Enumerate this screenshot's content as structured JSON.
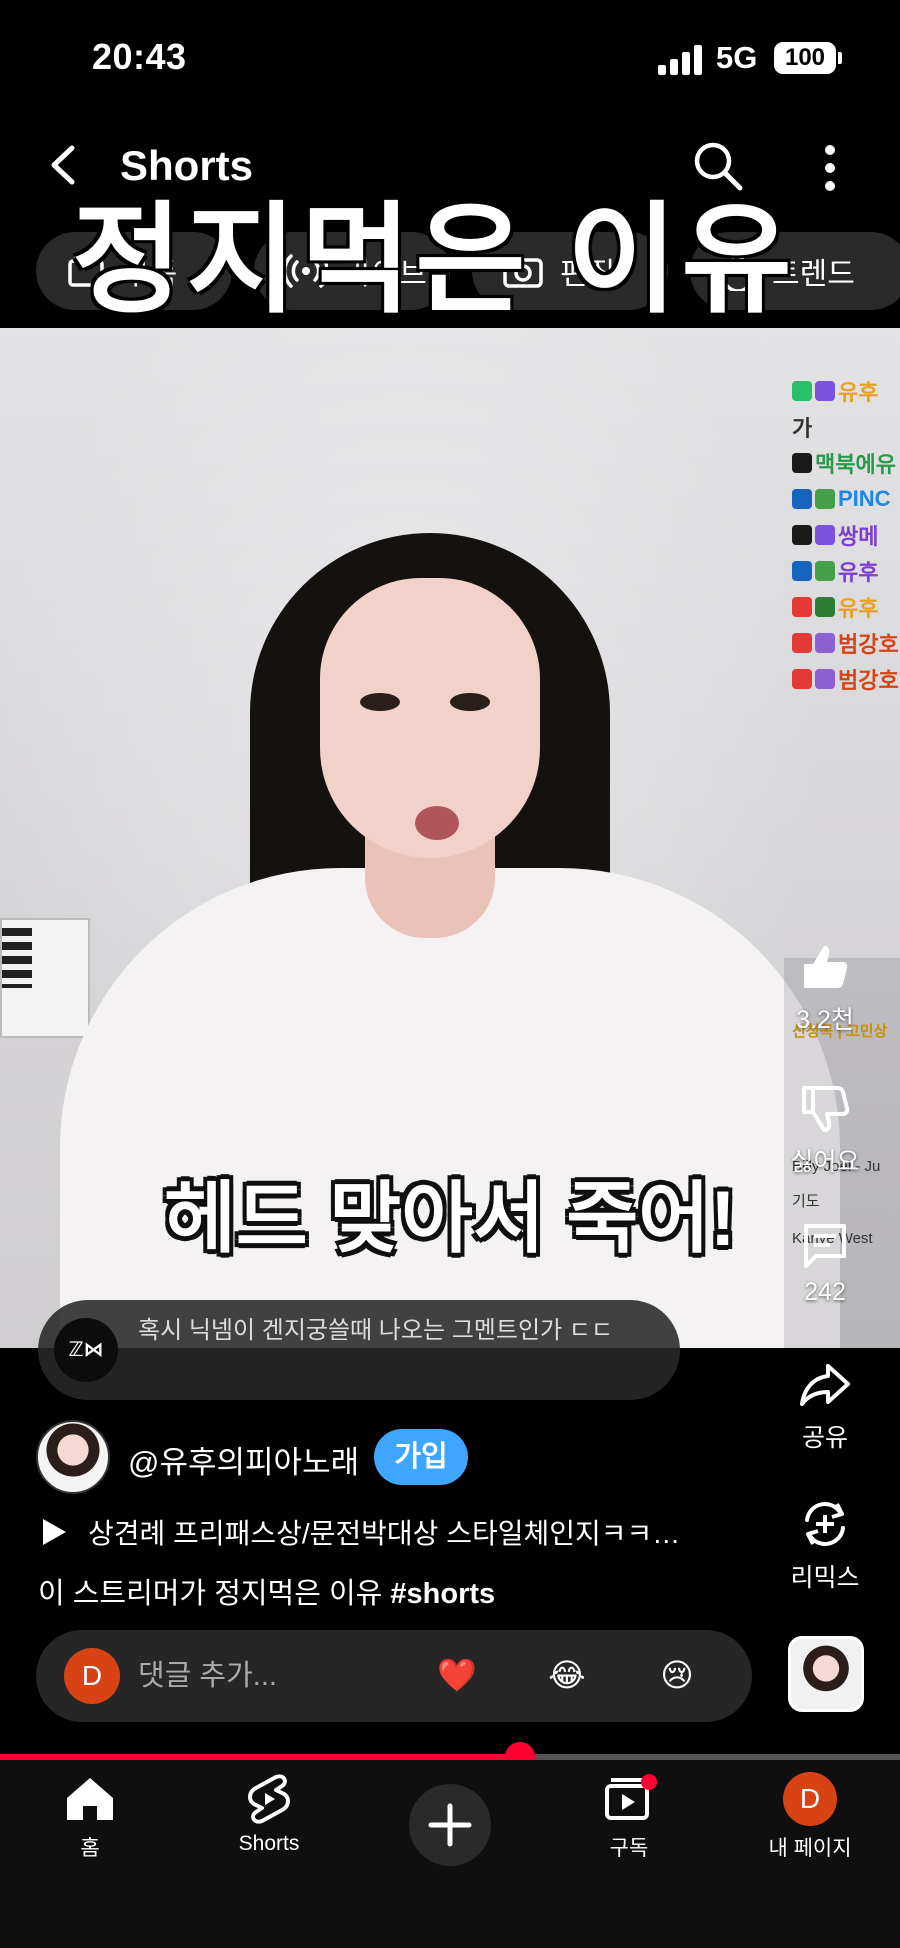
{
  "status": {
    "time": "20:43",
    "network": "5G",
    "battery": "100"
  },
  "header": {
    "title": "Shorts",
    "back_icon": "chevron-left-icon",
    "search_icon": "search-icon",
    "more_icon": "more-vert-icon"
  },
  "chips": [
    {
      "label": "구독",
      "icon": "subscriptions-icon"
    },
    {
      "label": "라이브",
      "icon": "live-icon"
    },
    {
      "label": "편집",
      "icon": "camera-icon"
    },
    {
      "label": "트렌드",
      "icon": "trend-icon"
    }
  ],
  "video": {
    "overlay_title": "정지먹은 이유",
    "subtitle": "헤드 맞아서 죽어!",
    "chat_lines": [
      "유후",
      "가",
      "맥북에유",
      "PINC",
      "쌍메",
      "유후",
      "유후",
      "범강호",
      "범강호"
    ],
    "song_panel": [
      "신청곡 | 고민상",
      "Billy Joel - Ju",
      "기도",
      "Kanye West"
    ]
  },
  "rail": {
    "likes": "3.2천",
    "dislike_label": "싫어요",
    "comments": "242",
    "share_label": "공유",
    "remix_label": "리믹스"
  },
  "pinned_comment": {
    "logo_text": "ℤ⋈",
    "text": "혹시 닉넴이 겐지궁쓸때 나오는 그멘트인가 ㄷㄷ"
  },
  "channel": {
    "handle": "@유후의피아노래",
    "join_label": "가입"
  },
  "music": {
    "text": "상견례 프리패스상/문전박대상 스타일체인지ㅋㅋ…"
  },
  "description": {
    "text": "이 스트리머가 정지먹은 이유 ",
    "hashtag": "#shorts"
  },
  "comment_bar": {
    "avatar_letter": "D",
    "placeholder": "댓글 추가...",
    "emojis": [
      "❤️",
      "😂",
      "😢"
    ]
  },
  "progress": {
    "fraction": 0.578
  },
  "nav": {
    "home": "홈",
    "shorts": "Shorts",
    "subscriptions": "구독",
    "me": "내 페이지",
    "me_letter": "D"
  },
  "colors": {
    "accent": "#ff0033",
    "join": "#3ea6ff",
    "avatar": "#d84315"
  }
}
